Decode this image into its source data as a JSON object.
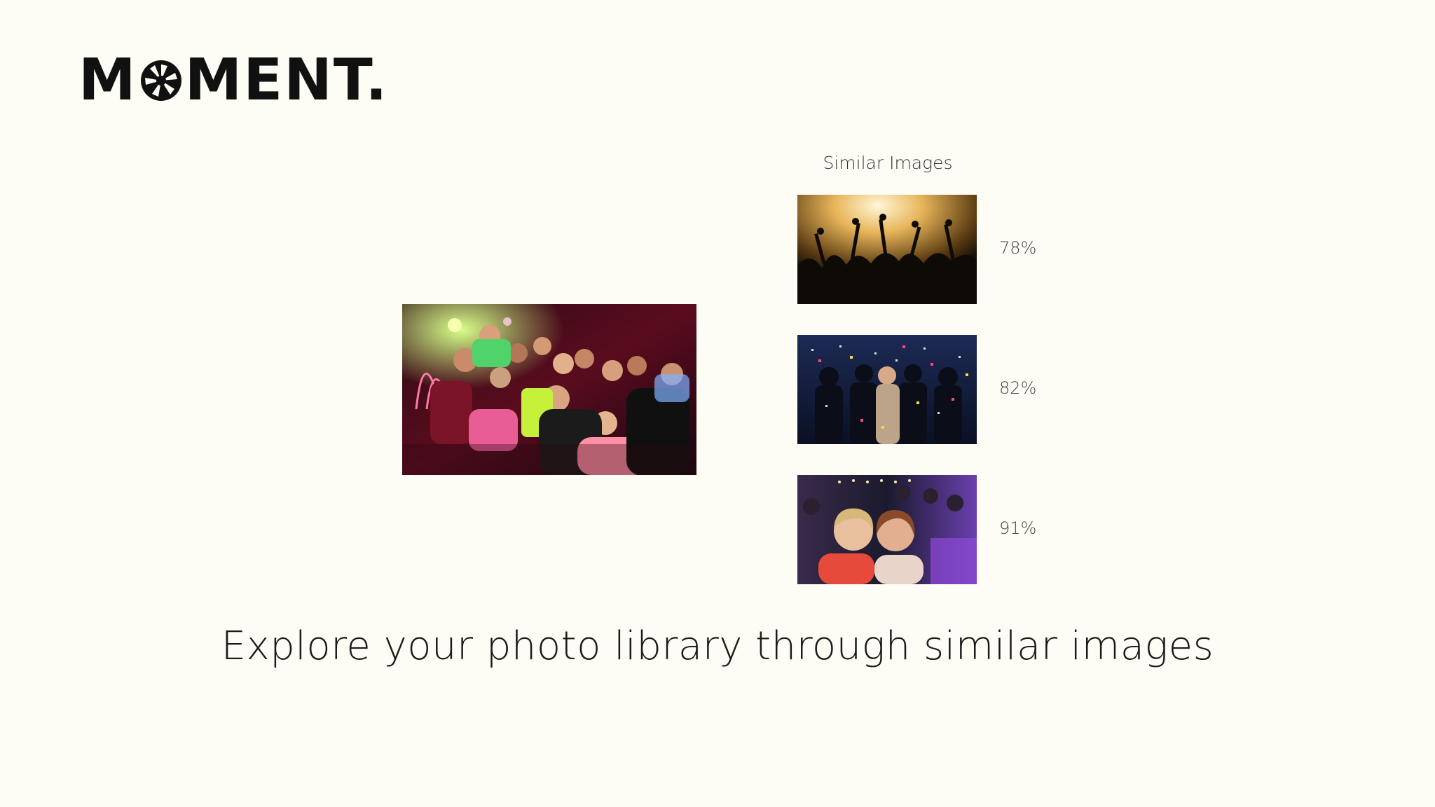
{
  "brand": {
    "logo_text_before": "M",
    "logo_text_after": "MENT.",
    "logo_icon": "camera-aperture-icon"
  },
  "main_image": {
    "description_icon": "group-party-photo"
  },
  "similar": {
    "title": "Similar Images",
    "items": [
      {
        "score": "78%",
        "photo": "concert-crowd-photo"
      },
      {
        "score": "82%",
        "photo": "confetti-party-photo"
      },
      {
        "score": "91%",
        "photo": "two-women-selfie-photo"
      }
    ]
  },
  "tagline": "Explore your photo library through similar images",
  "colors": {
    "background": "#fefdf5",
    "text": "#1e1e1e"
  }
}
